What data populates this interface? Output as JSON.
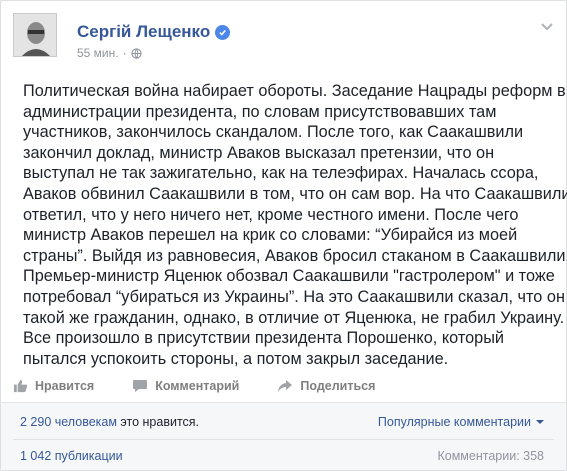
{
  "post": {
    "author": "Сергій Лещенко",
    "timestamp": "55 мин.",
    "separator": "·",
    "text_lines": [
      "Политическая война набирает обороты. Заседание Нацрады реформ в",
      "администрации президента, по словам присутствовавших там",
      "участников, закончилось скандалом. После того, как Саакашвили",
      "закончил доклад, министр Аваков высказал претензии, что он",
      "выступал не так зажигательно, как на телеэфирах. Началась ссора,",
      "Аваков обвинил Саакашвили в том, что он сам вор. На что Саакашвили",
      "ответил, что у него ничего нет, кроме честного имени. После чего",
      "министр Аваков перешел на крик со словами: “Убирайся из моей",
      "страны”. Выйдя из равновесия, Аваков бросил стаканом в Саакашвили.",
      "Премьер-министр Яценюк обозвал Саакашвили \"гастролером\" и тоже",
      "потребовал “убираться из Украины”. На это Саакашвили сказал, что он",
      "такой же гражданин, однако, в отличие от Яценюка, не грабил Украину.",
      "Все произошло в присутствии президента Порошенко, который",
      "пытался успокоить стороны, а потом закрыл заседание."
    ]
  },
  "actions": {
    "like": "Нравится",
    "comment": "Комментарий",
    "share": "Поделиться"
  },
  "footer": {
    "likes_count": "2 290 человекам",
    "likes_suffix": " это нравится.",
    "sort_label": "Популярные комментарии",
    "shares": "1 042 публикации",
    "comments": "Комментарии: 358"
  },
  "colors": {
    "link": "#365899",
    "verified": "#4c86e8",
    "muted": "#90949c",
    "action": "#7f7f7f"
  },
  "icons": [
    "avatar",
    "verified-badge-icon",
    "globe-icon",
    "chevron-down-icon",
    "like-icon",
    "comment-icon",
    "share-icon"
  ]
}
